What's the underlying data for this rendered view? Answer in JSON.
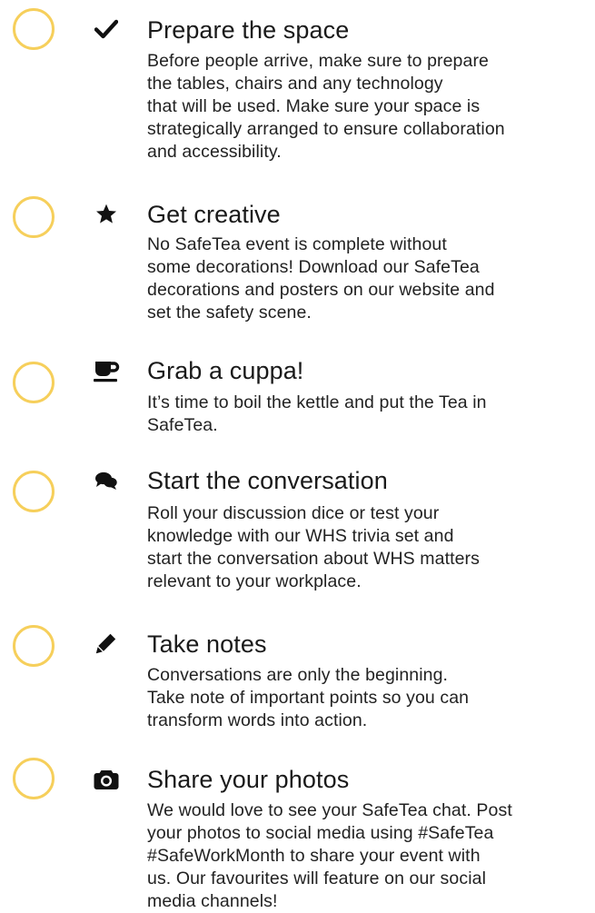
{
  "items": [
    {
      "title": "Prepare the space",
      "icon": "check-icon",
      "checked": false,
      "lines": [
        "Before people arrive, make sure to prepare",
        "the tables, chairs and any technology",
        "that will be used. Make sure your space is",
        "strategically arranged to ensure collaboration",
        "and accessibility."
      ]
    },
    {
      "title": "Get creative",
      "icon": "star-icon",
      "checked": false,
      "lines": [
        "No SafeTea event is complete without",
        "some decorations! Download our SafeTea",
        "decorations and posters on our website and",
        "set the safety scene."
      ]
    },
    {
      "title": "Grab a cuppa!",
      "icon": "coffee-cup-icon",
      "checked": false,
      "lines": [
        "It’s time to boil the kettle and put the Tea in",
        "SafeTea."
      ]
    },
    {
      "title": "Start the conversation",
      "icon": "chat-bubbles-icon",
      "checked": false,
      "lines": [
        "Roll your discussion dice or test your",
        "knowledge with our WHS trivia set and",
        "start the conversation about WHS matters",
        "relevant to your workplace."
      ]
    },
    {
      "title": "Take notes",
      "icon": "pencil-icon",
      "checked": false,
      "lines": [
        "Conversations are only the beginning.",
        "Take note of important points so you can",
        "transform words into action."
      ]
    },
    {
      "title": "Share your photos",
      "icon": "camera-icon",
      "checked": false,
      "lines": [
        "We would love to see your SafeTea chat. Post",
        "your photos to social media using #SafeTea",
        "#SafeWorkMonth to share your event with",
        "us. Our favourites will feature on our social",
        "media channels!"
      ]
    }
  ],
  "colors": {
    "checkbox_ring": "#f6cf5b",
    "text": "#1a1a1a"
  }
}
